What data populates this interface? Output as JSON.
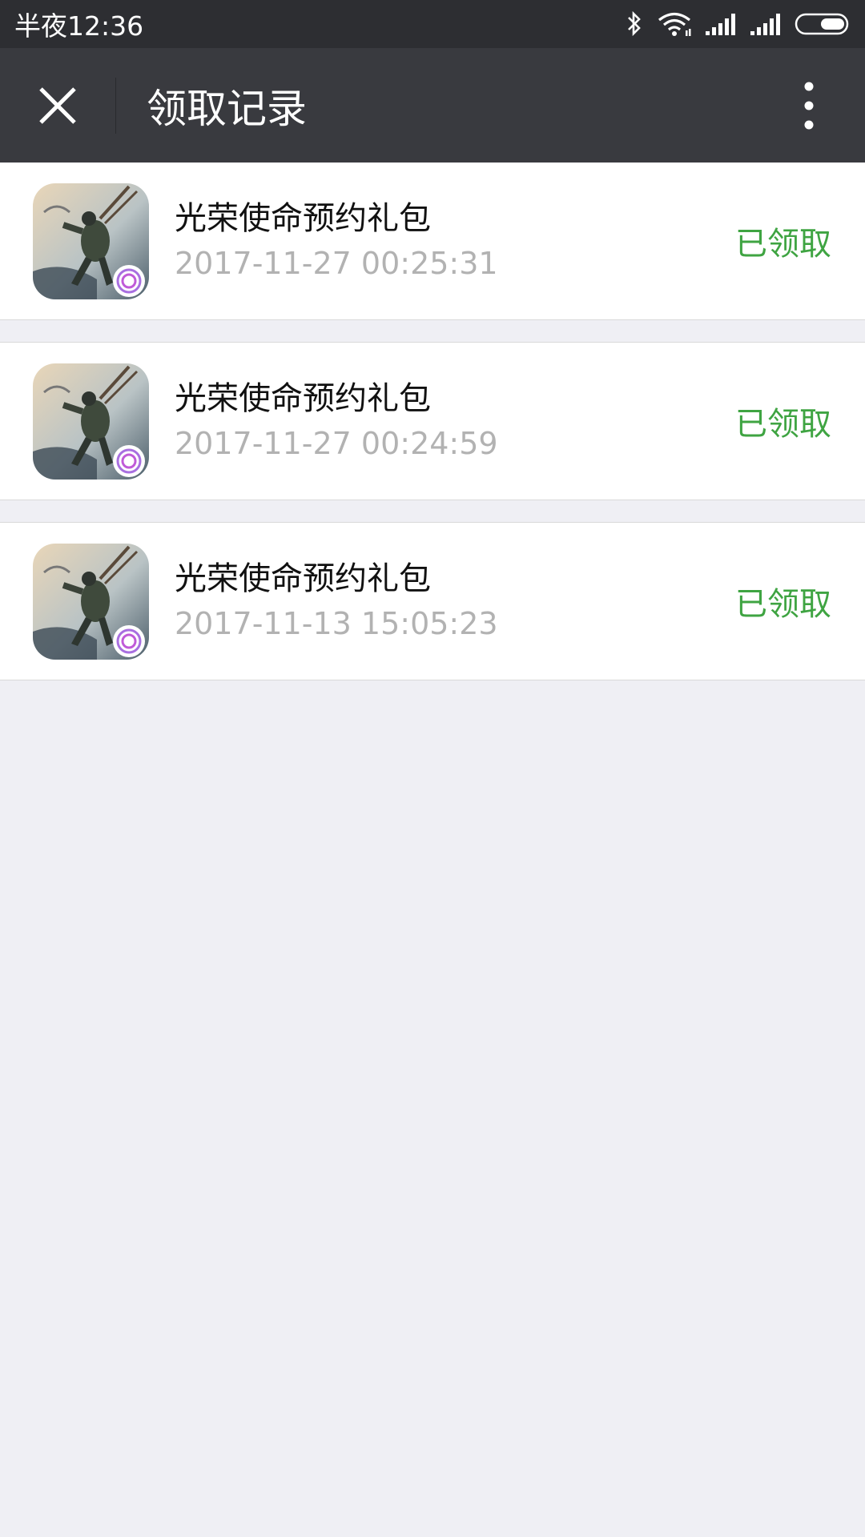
{
  "status_bar": {
    "time": "半夜12:36"
  },
  "nav": {
    "title": "领取记录",
    "close_icon": "close-icon",
    "more_icon": "more-vertical-icon"
  },
  "colors": {
    "status_bar_bg": "#2d2e32",
    "nav_bg": "#393a3f",
    "page_bg": "#efeff4",
    "claimed_green": "#3fa442",
    "time_gray": "#b2b2b2"
  },
  "records": [
    {
      "title": "光荣使命预约礼包",
      "time": "2017-11-27 00:25:31",
      "status": "已领取"
    },
    {
      "title": "光荣使命预约礼包",
      "time": "2017-11-27 00:24:59",
      "status": "已领取"
    },
    {
      "title": "光荣使命预约礼包",
      "time": "2017-11-13 15:05:23",
      "status": "已领取"
    }
  ]
}
